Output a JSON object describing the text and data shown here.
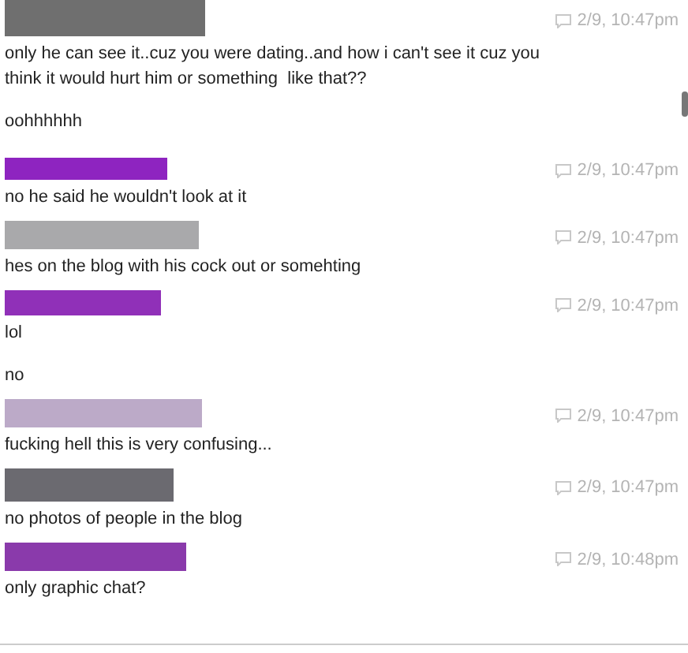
{
  "messages": [
    {
      "color": "#6f6f6f",
      "time": "2/9, 10:47pm",
      "lines": [
        "only he can see it..cuz you were dating..and how i can't see it cuz you think it would hurt him or something  like that??",
        "oohhhhhh"
      ]
    },
    {
      "color": "#8e24c0",
      "time": "2/9, 10:47pm",
      "lines": [
        "no he said he wouldn't look at it"
      ]
    },
    {
      "color": "#a9a9ab",
      "time": "2/9, 10:47pm",
      "lines": [
        "hes on the blog with his cock out or somehting"
      ]
    },
    {
      "color": "#9030b8",
      "time": "2/9, 10:47pm",
      "lines": [
        "lol",
        "no"
      ]
    },
    {
      "color": "#bcaac8",
      "time": "2/9, 10:47pm",
      "lines": [
        "fucking hell this is very confusing..."
      ]
    },
    {
      "color": "#6b6a70",
      "time": "2/9, 10:47pm",
      "lines": [
        "no photos of people in the blog"
      ]
    },
    {
      "color": "#8a3aab",
      "time": "2/9, 10:48pm",
      "lines": [
        "only graphic chat?"
      ]
    }
  ]
}
